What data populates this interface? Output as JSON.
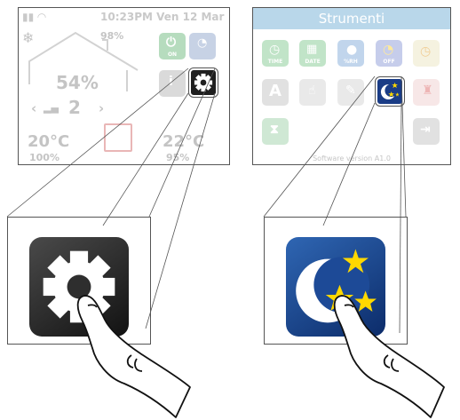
{
  "left_screen": {
    "status_time": "10:23PM Ven 12 Mar",
    "humidity_small": "98%",
    "humidity_big": "54%",
    "level": "2",
    "temp_left": "20°C",
    "temp_right": "22°C",
    "pct_left": "100%",
    "pct_right": "95%",
    "onoff_label": "ON"
  },
  "right_screen": {
    "title": "Strumenti",
    "tiles": [
      {
        "label": "TIME"
      },
      {
        "label": "DATE"
      },
      {
        "label": "%RH"
      },
      {
        "label": "OFF"
      },
      {
        "label": ""
      }
    ],
    "footer": "Software version A1.0"
  },
  "colors": {
    "gear_bg": "#1f1f1f",
    "moon_bg": "#1a3c86",
    "star": "#ffd800"
  },
  "icons": {
    "settings": "gear-icon",
    "night": "moon-stars-icon"
  }
}
